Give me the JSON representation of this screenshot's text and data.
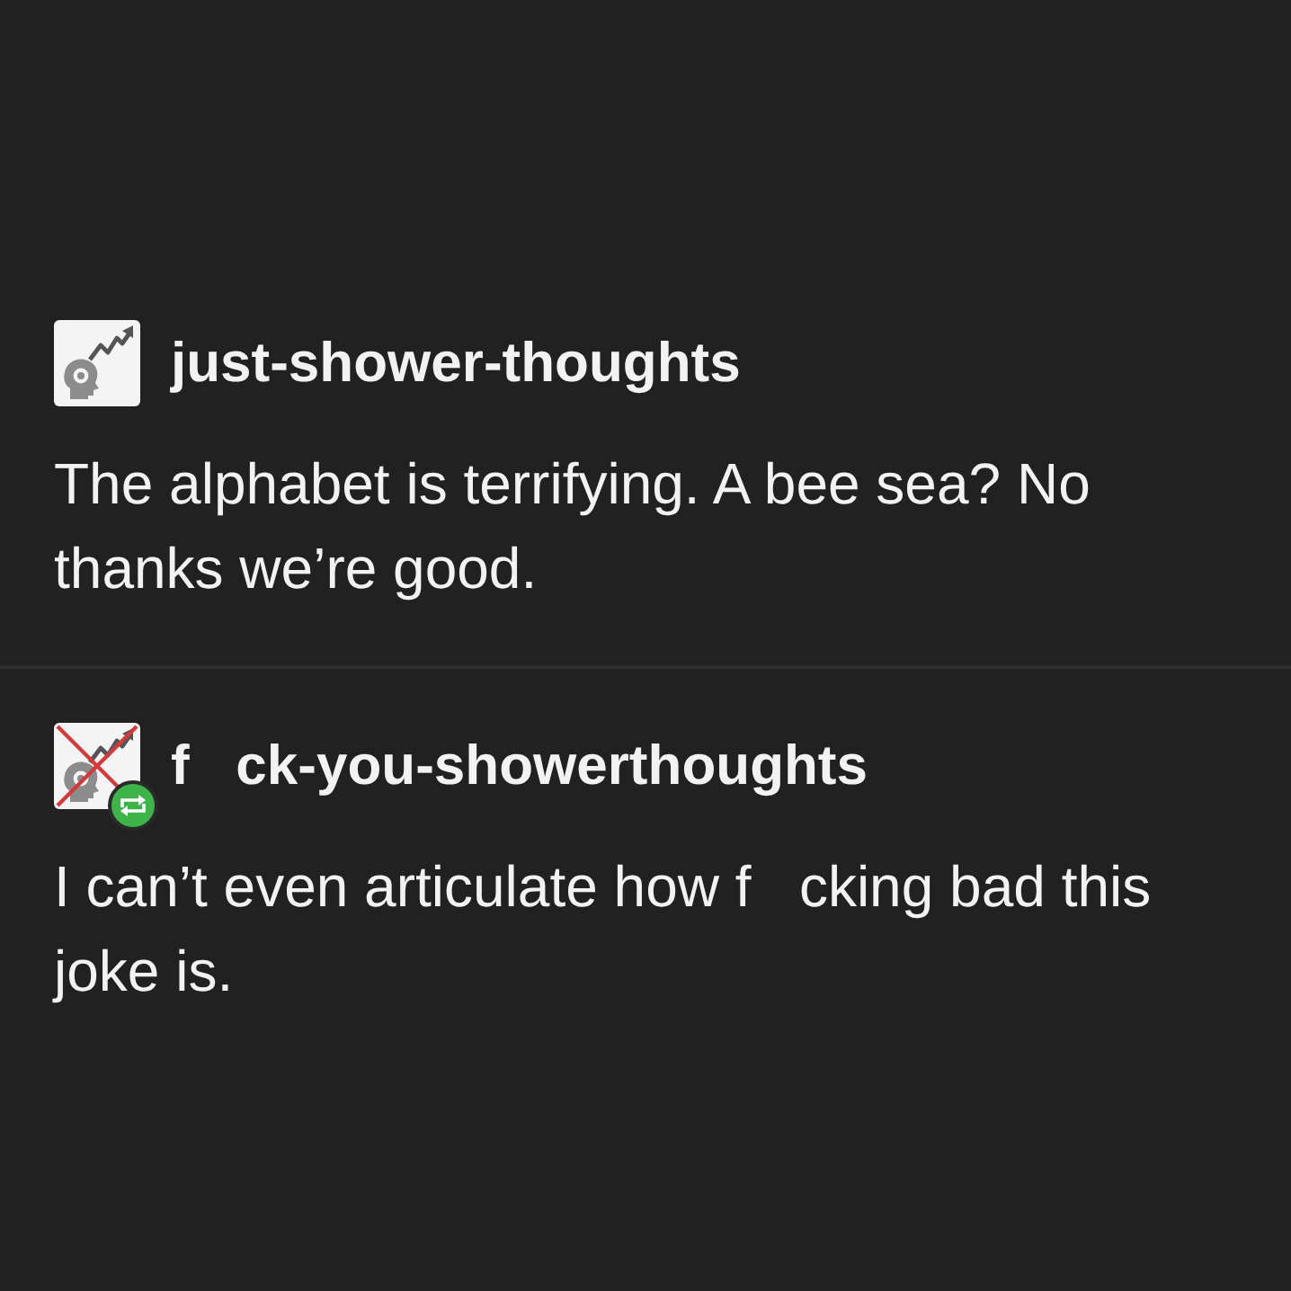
{
  "posts": [
    {
      "username": "just-shower-thoughts",
      "crossed_out": false,
      "reblogged": false,
      "text": "The alphabet is terrifying. A bee sea? No thanks we’re good."
    },
    {
      "username": "f   ck-you-showerthoughts",
      "crossed_out": true,
      "reblogged": true,
      "text": "I can’t even articulate how f   cking bad this joke is."
    }
  ]
}
